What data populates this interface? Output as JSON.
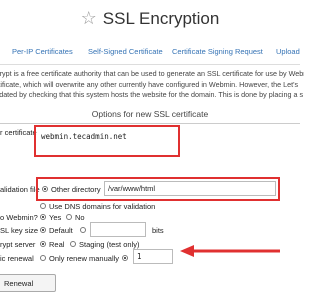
{
  "page": {
    "title": "SSL Encryption",
    "star_icon": "star-icon"
  },
  "tabs": [
    {
      "label": "Per-IP Certificates"
    },
    {
      "label": "Self-Signed Certificate"
    },
    {
      "label": "Certificate Signing Request"
    },
    {
      "label": "Upload C"
    }
  ],
  "intro": [
    "ncrypt is a free certificate authority that can be used to generate an SSL certificate for use by Webmin.",
    "ertificate, which will overwrite any other currently have configured in Webmin. However, the Let's",
    "alidated by checking that this system hosts the website for the domain. This is done by placing a s"
  ],
  "section": {
    "title": "Options for new SSL certificate"
  },
  "form": {
    "hostnames_label": "r certificate",
    "hostnames_value": "webmin.tecadmin.net",
    "validation_label": "alidation file",
    "other_directory_label": "Other directory",
    "other_directory_value": "/var/www/html",
    "use_dns_label": "Use DNS domains for validation",
    "copy_label": "o Webmin?",
    "copy_yes": "Yes",
    "copy_no": "No",
    "keysize_label": "SL key size",
    "keysize_default": "Default",
    "keysize_unit": "bits",
    "server_label": "rypt server",
    "server_real": "Real",
    "server_staging": "Staging (test only)",
    "renewal_label": "ic renewal",
    "renew_manual": "Only renew manually",
    "renew_value": "1"
  },
  "button": {
    "label": " Renewal"
  },
  "colors": {
    "highlight": "#e03030",
    "link": "#3573b5"
  }
}
